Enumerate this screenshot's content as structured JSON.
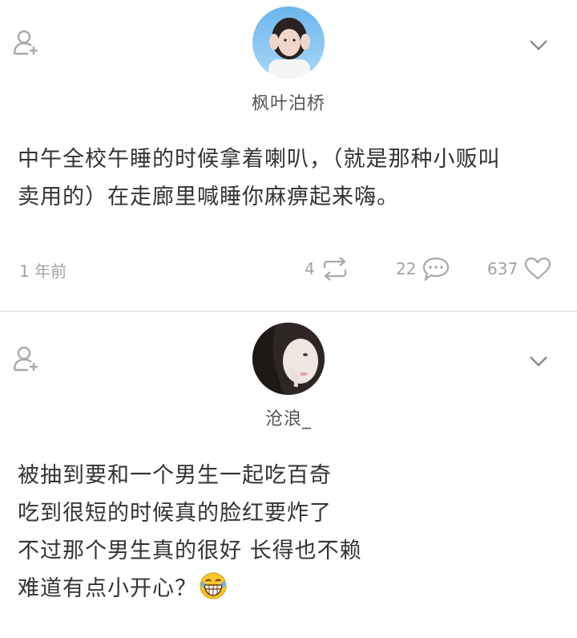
{
  "posts": [
    {
      "username": "枫叶泊桥",
      "content_lines": [
        "中午全校午睡的时候拿着喇叭，（就是那种小贩叫",
        "卖用的）在走廊里喊睡你麻痹起来嗨。"
      ],
      "time": "1 年前",
      "reposts": "4",
      "comments": "22",
      "likes": "637",
      "icons": {
        "follow": "add-user-icon",
        "menu": "chevron-down-icon",
        "repost": "repost-icon",
        "comment": "comment-icon",
        "like": "heart-icon"
      }
    },
    {
      "username": "沧浪_",
      "content_lines": [
        "被抽到要和一个男生一起吃百奇",
        "吃到很短的时候真的脸红要炸了",
        "不过那个男生真的很好 长得也不赖",
        "难道有点小开心？"
      ],
      "emoji": "laughing-emoji",
      "icons": {
        "follow": "add-user-icon",
        "menu": "chevron-down-icon"
      }
    }
  ],
  "colors": {
    "text": "#333333",
    "meta": "#a2a2a2",
    "icon": "#a8a8a8",
    "divider": "#e6e6e6"
  }
}
